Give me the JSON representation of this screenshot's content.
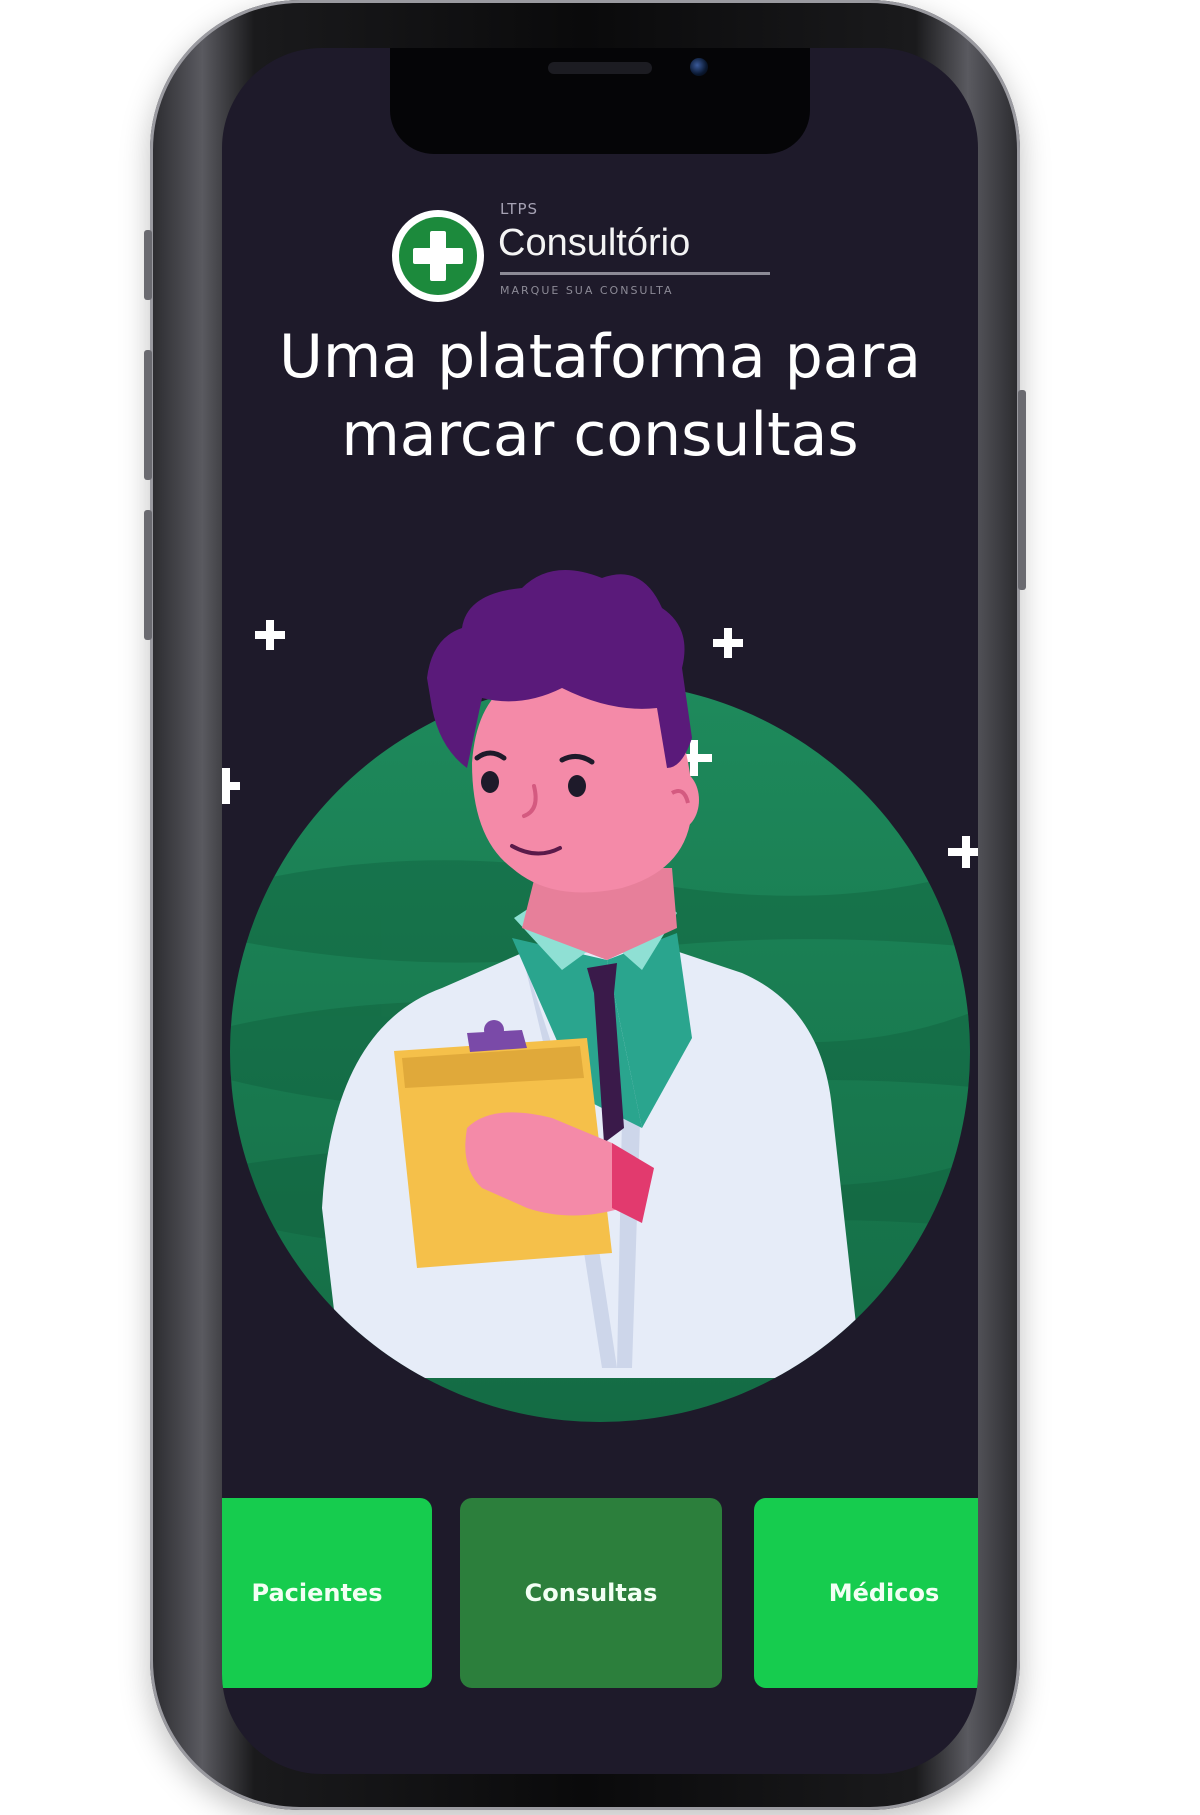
{
  "brand": {
    "small_label": "LTPS",
    "name": "Consultório",
    "tagline": "MARQUE SUA CONSULTA"
  },
  "hero": {
    "line1": "Uma plataforma para",
    "line2": "marcar consultas"
  },
  "nav": {
    "pacientes": "Pacientes",
    "consultas": "Consultas",
    "medicos": "Médicos"
  },
  "colors": {
    "background": "#1e1a2a",
    "brand_green": "#1c8a3c",
    "card_green": "#16cc4e",
    "card_active": "#2c7f3c",
    "circle_green": "#1a7a52"
  },
  "icons": [
    "medical-cross-icon",
    "sparkle-plus-icon"
  ]
}
